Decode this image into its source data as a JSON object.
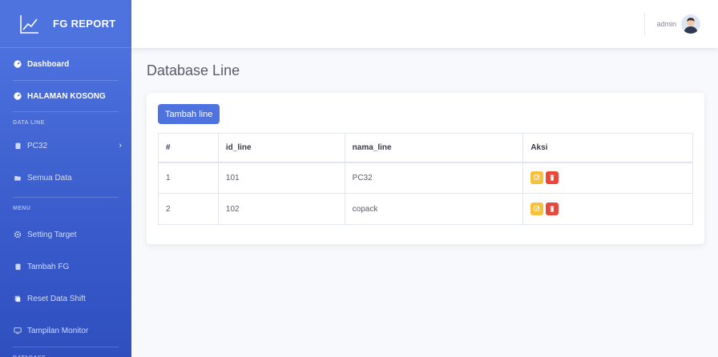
{
  "brand": {
    "title": "FG REPORT",
    "icon": "chart-line-icon"
  },
  "sidebar": {
    "items": [
      {
        "label": "Dashboard",
        "icon": "tachometer-icon",
        "active": true
      },
      {
        "label": "HALAMAN KOSONG",
        "icon": "tachometer-icon",
        "active": true
      },
      {
        "heading": "DATA LINE"
      },
      {
        "label": "PC32",
        "icon": "clipboard-icon",
        "chevron": "›"
      },
      {
        "label": "Semua Data",
        "icon": "folder-icon"
      },
      {
        "heading": "MENU"
      },
      {
        "label": "Setting Target",
        "icon": "gears-icon"
      },
      {
        "label": "Tambah FG",
        "icon": "clipboard-icon"
      },
      {
        "label": "Reset Data Shift",
        "icon": "refresh-icon"
      },
      {
        "label": "Tampilan Monitor",
        "icon": "desktop-icon"
      },
      {
        "heading": "DATABASE"
      }
    ]
  },
  "topbar": {
    "username": "admin"
  },
  "main": {
    "title": "Database Line",
    "add_button": "Tambah line",
    "table": {
      "headers": [
        "#",
        "id_line",
        "nama_line",
        "Aksi"
      ],
      "rows": [
        {
          "no": "1",
          "id_line": "101",
          "nama_line": "PC32"
        },
        {
          "no": "2",
          "id_line": "102",
          "nama_line": "copack"
        }
      ]
    }
  },
  "colors": {
    "primary": "#4e73df",
    "warning": "#f6c23e",
    "danger": "#e74a3b"
  }
}
